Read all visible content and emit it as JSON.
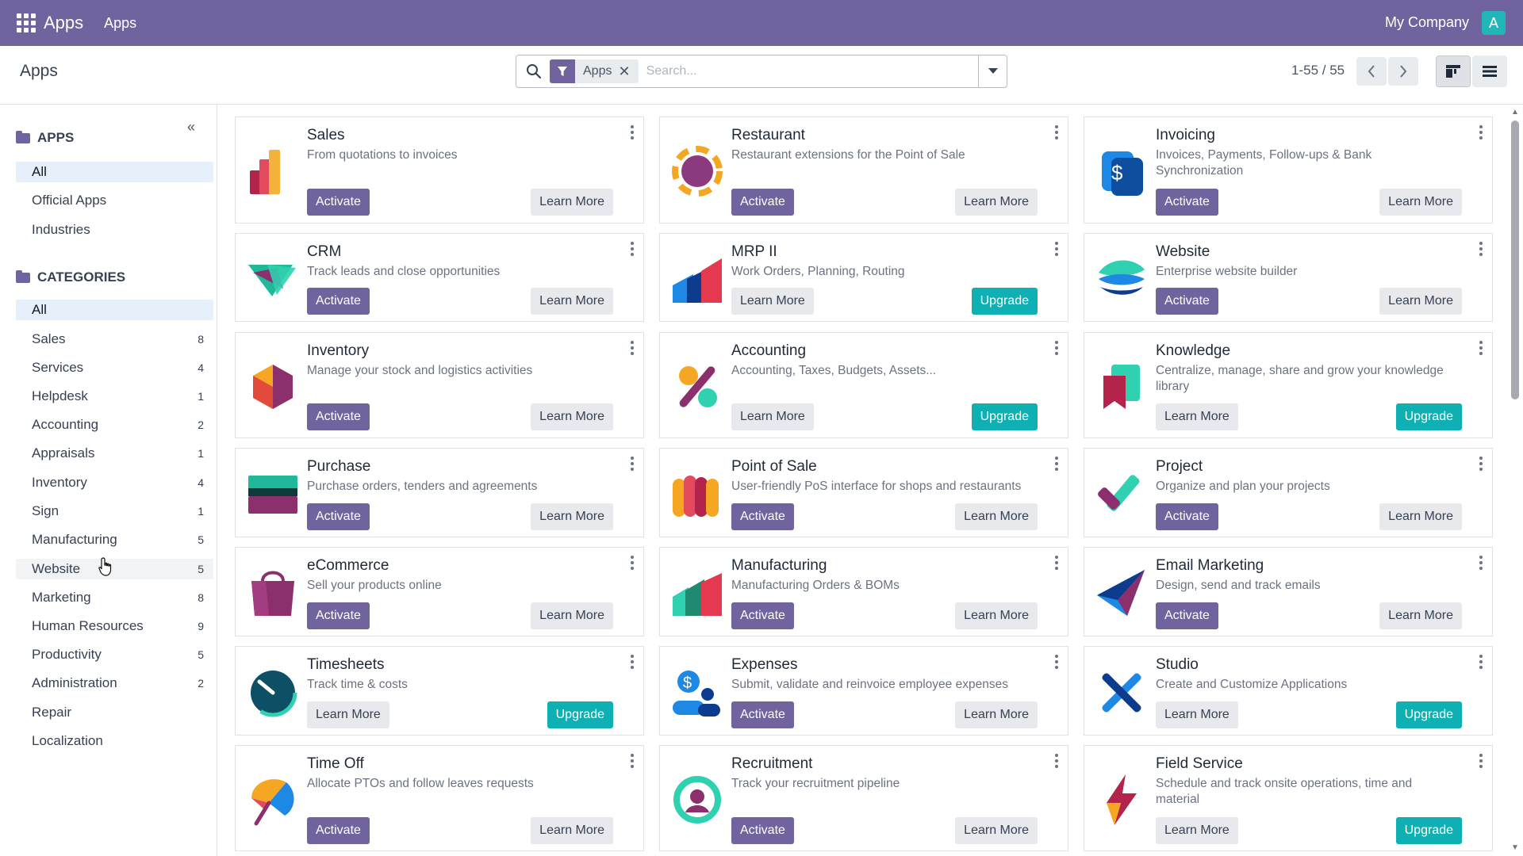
{
  "navbar": {
    "brand": "Apps",
    "menu_item": "Apps",
    "company": "My Company",
    "avatar_letter": "A"
  },
  "control": {
    "title": "Apps",
    "search": {
      "facet_label": "Apps",
      "facet_remove": "✕",
      "placeholder": "Search..."
    },
    "pager": "1-55 / 55"
  },
  "sidebar": {
    "collapse": "«",
    "apps_heading": "APPS",
    "apps_items": [
      "All",
      "Official Apps",
      "Industries"
    ],
    "categories_heading": "CATEGORIES",
    "categories": [
      {
        "label": "All",
        "count": ""
      },
      {
        "label": "Sales",
        "count": "8"
      },
      {
        "label": "Services",
        "count": "4"
      },
      {
        "label": "Helpdesk",
        "count": "1"
      },
      {
        "label": "Accounting",
        "count": "2"
      },
      {
        "label": "Appraisals",
        "count": "1"
      },
      {
        "label": "Inventory",
        "count": "4"
      },
      {
        "label": "Sign",
        "count": "1"
      },
      {
        "label": "Manufacturing",
        "count": "5"
      },
      {
        "label": "Website",
        "count": "5"
      },
      {
        "label": "Marketing",
        "count": "8"
      },
      {
        "label": "Human Resources",
        "count": "9"
      },
      {
        "label": "Productivity",
        "count": "5"
      },
      {
        "label": "Administration",
        "count": "2"
      },
      {
        "label": "Repair",
        "count": ""
      },
      {
        "label": "Localization",
        "count": ""
      }
    ]
  },
  "buttons": {
    "activate": "Activate",
    "learn_more": "Learn More",
    "upgrade": "Upgrade"
  },
  "colors": {
    "brand": "#71639e",
    "upgrade": "#0fb0b3",
    "active_category": "#e6f0fa"
  },
  "apps": [
    {
      "title": "Sales",
      "desc": "From quotations to invoices",
      "icon": "sales-icon",
      "mode": "activate"
    },
    {
      "title": "Restaurant",
      "desc": "Restaurant extensions for the Point of Sale",
      "icon": "restaurant-icon",
      "mode": "activate"
    },
    {
      "title": "Invoicing",
      "desc": "Invoices, Payments, Follow-ups & Bank Synchronization",
      "icon": "invoicing-icon",
      "mode": "activate"
    },
    {
      "title": "CRM",
      "desc": "Track leads and close opportunities",
      "icon": "crm-icon",
      "mode": "activate"
    },
    {
      "title": "MRP II",
      "desc": "Work Orders, Planning, Routing",
      "icon": "mrp-icon",
      "mode": "upgrade"
    },
    {
      "title": "Website",
      "desc": "Enterprise website builder",
      "icon": "website-icon",
      "mode": "activate"
    },
    {
      "title": "Inventory",
      "desc": "Manage your stock and logistics activities",
      "icon": "inventory-icon",
      "mode": "activate"
    },
    {
      "title": "Accounting",
      "desc": "Accounting, Taxes, Budgets, Assets...",
      "icon": "accounting-icon",
      "mode": "upgrade"
    },
    {
      "title": "Knowledge",
      "desc": "Centralize, manage, share and grow your knowledge library",
      "icon": "knowledge-icon",
      "mode": "upgrade"
    },
    {
      "title": "Purchase",
      "desc": "Purchase orders, tenders and agreements",
      "icon": "purchase-icon",
      "mode": "activate"
    },
    {
      "title": "Point of Sale",
      "desc": "User-friendly PoS interface for shops and restaurants",
      "icon": "point-of-sale-icon",
      "mode": "activate"
    },
    {
      "title": "Project",
      "desc": "Organize and plan your projects",
      "icon": "project-icon",
      "mode": "activate"
    },
    {
      "title": "eCommerce",
      "desc": "Sell your products online",
      "icon": "ecommerce-icon",
      "mode": "activate"
    },
    {
      "title": "Manufacturing",
      "desc": "Manufacturing Orders & BOMs",
      "icon": "manufacturing-icon",
      "mode": "activate"
    },
    {
      "title": "Email Marketing",
      "desc": "Design, send and track emails",
      "icon": "email-marketing-icon",
      "mode": "activate"
    },
    {
      "title": "Timesheets",
      "desc": "Track time & costs",
      "icon": "timesheets-icon",
      "mode": "upgrade"
    },
    {
      "title": "Expenses",
      "desc": "Submit, validate and reinvoice employee expenses",
      "icon": "expenses-icon",
      "mode": "activate"
    },
    {
      "title": "Studio",
      "desc": "Create and Customize Applications",
      "icon": "studio-icon",
      "mode": "upgrade"
    },
    {
      "title": "Time Off",
      "desc": "Allocate PTOs and follow leaves requests",
      "icon": "time-off-icon",
      "mode": "activate"
    },
    {
      "title": "Recruitment",
      "desc": "Track your recruitment pipeline",
      "icon": "recruitment-icon",
      "mode": "activate"
    },
    {
      "title": "Field Service",
      "desc": "Schedule and track onsite operations, time and material",
      "icon": "field-service-icon",
      "mode": "upgrade"
    }
  ]
}
